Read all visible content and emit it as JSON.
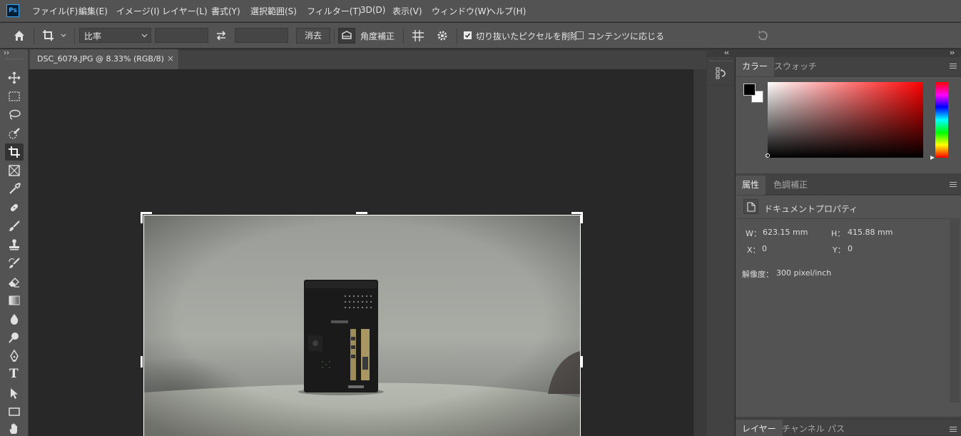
{
  "app": {
    "logo_text": "Ps",
    "menu": [
      "ファイル(F)",
      "編集(E)",
      "イメージ(I)",
      "レイヤー(L)",
      "書式(Y)",
      "選択範囲(S)",
      "フィルター(T)",
      "3D(D)",
      "表示(V)",
      "ウィンドウ(W)",
      "ヘルプ(H)"
    ]
  },
  "options_bar": {
    "ratio_select": "比率",
    "ratio_width_value": "",
    "ratio_height_value": "",
    "clear_button": "消去",
    "straighten_label": "角度補正",
    "delete_cropped_label": "切り抜いたピクセルを削除",
    "delete_cropped_checked": true,
    "content_aware_label": "コンテンツに応じる",
    "content_aware_checked": false
  },
  "document": {
    "tab_title": "DSC_6079.JPG @ 8.33% (RGB/8)",
    "close_glyph": "×"
  },
  "toolbar": {
    "tools": [
      "move-tool",
      "rectangular-marquee-tool",
      "lasso-tool",
      "quick-selection-tool",
      "crop-tool",
      "frame-tool",
      "eyedropper-tool",
      "spot-healing-brush-tool",
      "brush-tool",
      "clone-stamp-tool",
      "history-brush-tool",
      "eraser-tool",
      "gradient-tool",
      "blur-tool",
      "dodge-tool",
      "pen-tool",
      "type-tool",
      "path-selection-tool",
      "rectangle-tool",
      "hand-tool"
    ],
    "active_tool": "crop-tool",
    "type_tool_glyph": "T"
  },
  "color_panel": {
    "tabs": [
      "カラー",
      "スウォッチ"
    ],
    "active_tab": "カラー",
    "foreground_color": "#000000",
    "background_color": "#ffffff",
    "hue_color": "#ff0000"
  },
  "properties_panel": {
    "tabs": [
      "属性",
      "色調補正"
    ],
    "active_tab": "属性",
    "section_title": "ドキュメントプロパティ",
    "w_label": "W：",
    "w_value": "623.15 mm",
    "h_label": "H：",
    "h_value": "415.88 mm",
    "x_label": "X：",
    "x_value": "0",
    "y_label": "Y：",
    "y_value": "0",
    "resolution_label": "解像度：",
    "resolution_value": "300 pixel/inch"
  },
  "layers_panel": {
    "tabs": [
      "レイヤー",
      "チャンネル",
      "パス"
    ],
    "active_tab": "レイヤー"
  },
  "colors": {
    "chrome": "#535353",
    "panel_dark": "#424242",
    "canvas_bg": "#282828",
    "accent": "#31a8ff"
  }
}
